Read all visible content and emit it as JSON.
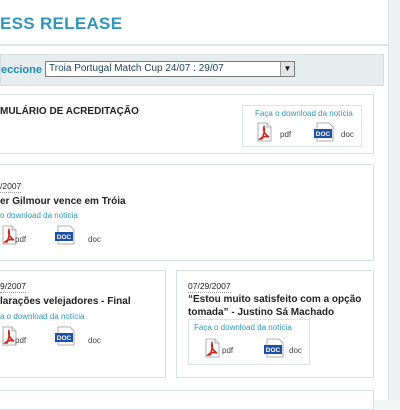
{
  "header": {
    "title": "ESS RELEASE"
  },
  "selector": {
    "label": "eccione",
    "selected": "Troia Portugal Match Cup 24/07 : 29/07",
    "arrow": "▼"
  },
  "accreditation": {
    "title": "MULÁRIO DE ACREDITAÇÃO",
    "download_label": "Faça o download da notícia",
    "pdf_label": "pdf",
    "doc_label": "doc"
  },
  "releases": [
    {
      "date": "/2007",
      "title": "er Gilmour vence em Tróia",
      "download_label": "o download da notícia",
      "pdf_label": "pdf",
      "doc_label": "doc"
    },
    {
      "date": "9/2007",
      "title": "larações velejadores - Final",
      "download_label": "a o download da notícia",
      "pdf_label": "pdf",
      "doc_label": "doc"
    },
    {
      "date": "07/29/2007",
      "title_line1": "“Estou muito satisfeito com a opção",
      "title_line2": "tomada” - Justino Sá Machado",
      "download_label": "Faça o download da notícia",
      "pdf_label": "pdf",
      "doc_label": "doc"
    }
  ],
  "icons": {
    "pdf": "pdf-icon",
    "doc": "doc-icon"
  },
  "colors": {
    "accent": "#2f98b8",
    "doc_blue": "#1d4fa3",
    "pdf_red": "#c62a22"
  }
}
